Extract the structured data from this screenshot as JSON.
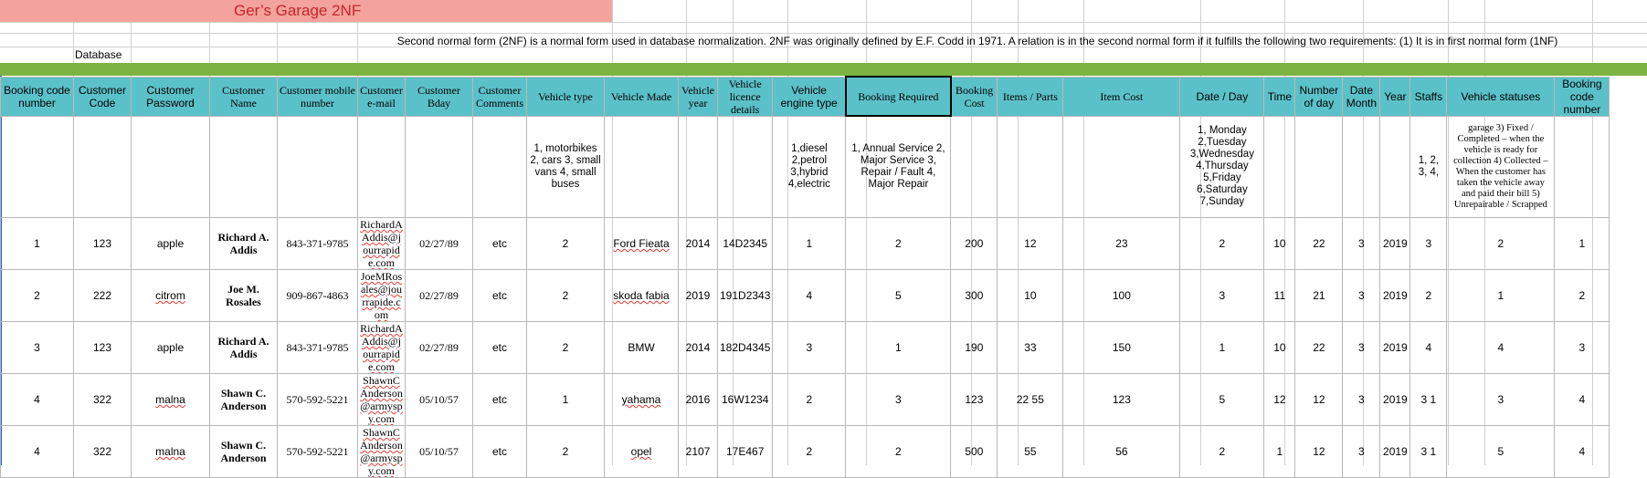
{
  "sheet_title": "Ger’s Garage    2NF",
  "database_label": "Database",
  "description": "Second normal form (2NF) is a normal form used in database normalization. 2NF was originally defined by E.F. Codd in 1971. A relation is in the second normal form if it fulfills the following two requirements: (1) It is in first normal form (1NF)",
  "headers": [
    "Booking code number",
    "Customer Code",
    "Customer Password",
    "Customer Name",
    "Customer mobile number",
    "Customer e-mail",
    "Customer Bday",
    "Customer Comments",
    "Vehicle  type",
    "Vehicle Made",
    "Vehicle year",
    "Vehicle licence details",
    "Vehicle engine type",
    "Booking Required",
    "Booking Cost",
    "Items / Parts",
    "Item Cost",
    "Date / Day",
    "Time",
    "Number of day",
    "Date Month",
    "Year",
    "Staffs",
    "Vehicle statuses",
    "Booking code number"
  ],
  "notes": {
    "vehicle_type": "1, motorbikes 2, cars 3, small vans 4, small buses",
    "engine_type": "1,diesel 2,petrol 3,hybrid 4,electric",
    "booking_required": "1, Annual Service 2, Major Service 3, Repair / Fault  4, Major Repair",
    "date_day": "1, Monday 2,Tuesday 3,Wednesday 4,Thursday 5,Friday 6,Saturday 7,Sunday",
    "staffs": "1, 2, 3, 4,",
    "vehicle_statuses": "garage 3) Fixed / Completed – when the vehicle is ready for collection 4) Collected – When the customer has taken the vehicle away and paid their bill 5) Unrepairable / Scrapped"
  },
  "rows": [
    [
      "1",
      "123",
      "apple",
      "Richard A. Addis",
      "843-371-9785",
      "RichardAAddis@jourrapide.com",
      "02/27/89",
      "etc",
      "2",
      "Ford Fieata",
      "2014",
      "14D2345",
      "1",
      "2",
      "200",
      "12",
      "23",
      "2",
      "10",
      "22",
      "3",
      "2019",
      "3",
      "2",
      "1"
    ],
    [
      "2",
      "222",
      "citrom",
      "Joe M. Rosales",
      "909-867-4863",
      "JoeMRosales@jourrapide.com",
      "02/27/89",
      "etc",
      "2",
      "skoda fabia",
      "2019",
      "191D2343",
      "4",
      "5",
      "300",
      "10",
      "100",
      "3",
      "11",
      "21",
      "3",
      "2019",
      "2",
      "1",
      "2"
    ],
    [
      "3",
      "123",
      "apple",
      "Richard A. Addis",
      "843-371-9785",
      "RichardAAddis@jourrapide.com",
      "02/27/89",
      "etc",
      "2",
      "BMW",
      "2014",
      "182D4345",
      "3",
      "1",
      "190",
      "33",
      "150",
      "1",
      "10",
      "22",
      "3",
      "2019",
      "4",
      "4",
      "3"
    ],
    [
      "4",
      "322",
      "malna",
      "Shawn C. Anderson",
      "570-592-5221",
      "ShawnCAnderson@armyspy.com",
      "05/10/57",
      "etc",
      "1",
      "yahama",
      "2016",
      "16W1234",
      "2",
      "3",
      "123",
      "22 55",
      "123",
      "5",
      "12",
      "12",
      "3",
      "2019",
      "3 1",
      "3",
      "4"
    ],
    [
      "4",
      "322",
      "malna",
      "Shawn C. Anderson",
      "570-592-5221",
      "ShawnCAnderson@armyspy.com",
      "05/10/57",
      "etc",
      "2",
      "opel",
      "2107",
      "17E467",
      "2",
      "2",
      "500",
      "55",
      "56",
      "2",
      "1",
      "12",
      "3",
      "2019",
      "3 1",
      "5",
      "4"
    ]
  ],
  "colors": {
    "title_bg": "#f4a29c",
    "title_text": "#c6262e",
    "header_bg": "#5bc1c9",
    "green_bar": "#7cb342"
  }
}
